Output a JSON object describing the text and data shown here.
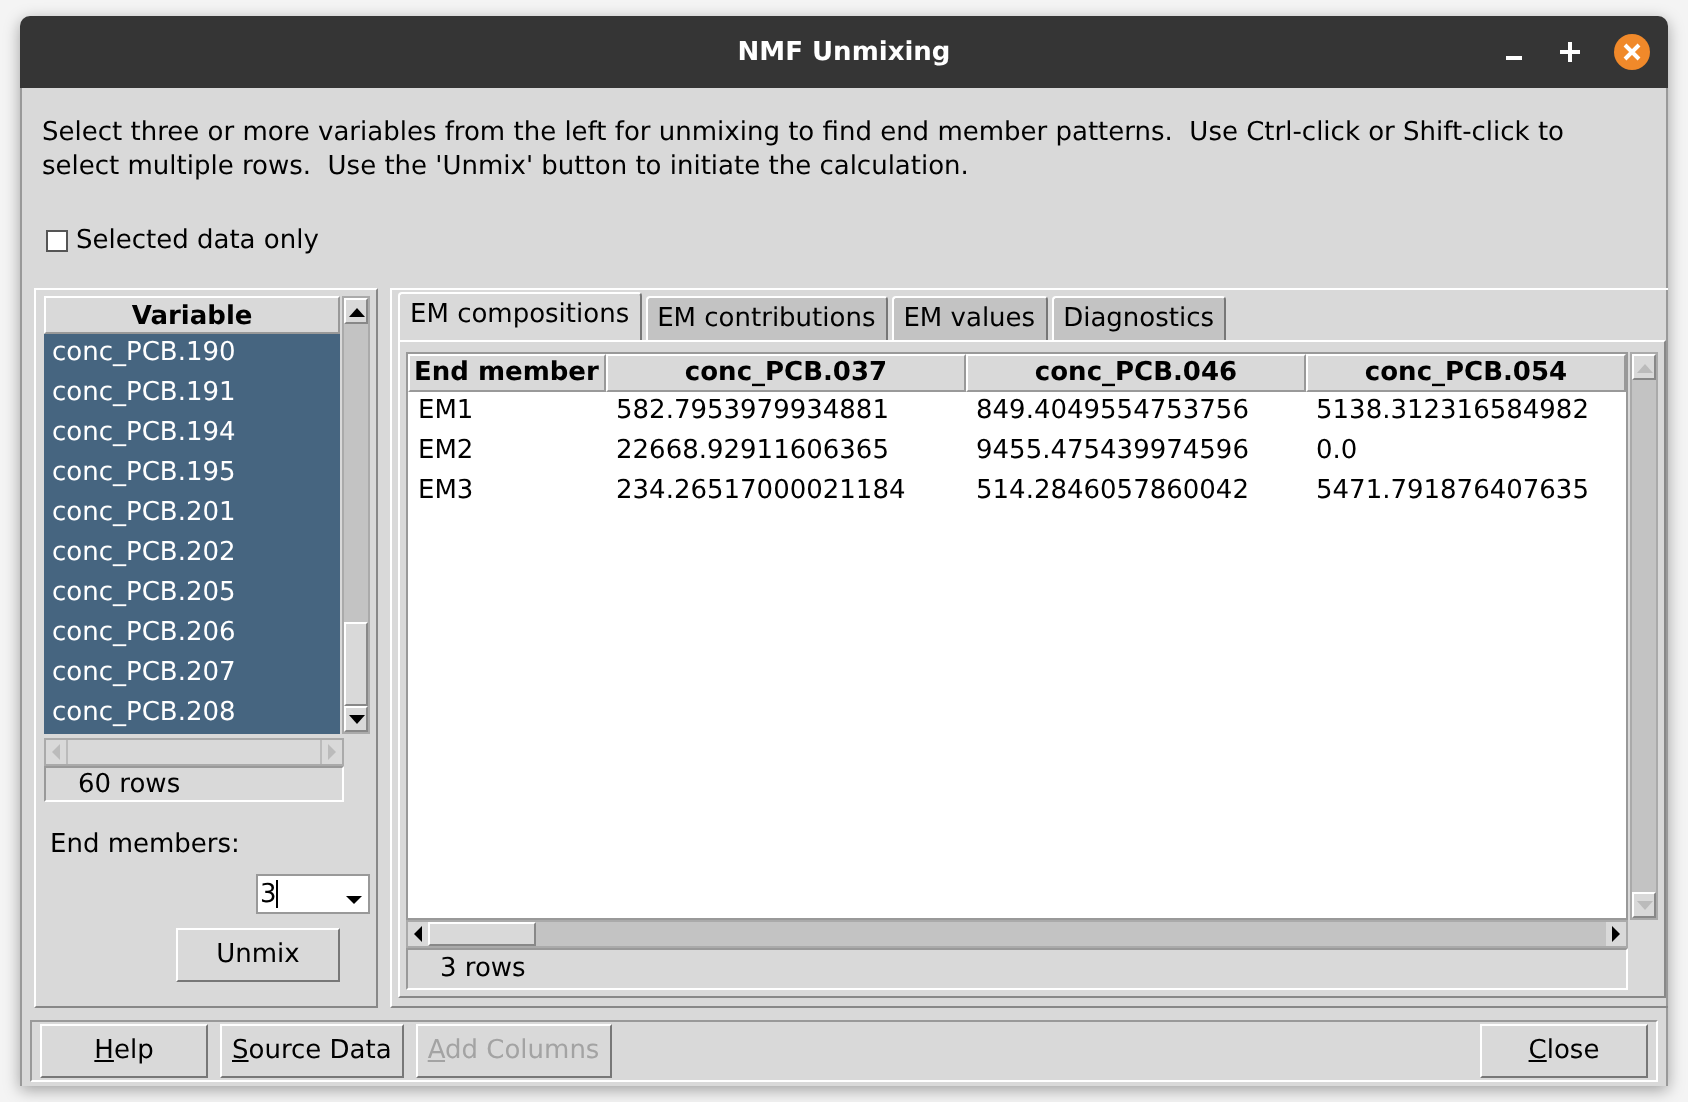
{
  "window": {
    "title": "NMF Unmixing"
  },
  "instructions": "Select three or more variables from the left for unmixing to find end member patterns.  Use Ctrl-click or Shift-click to select multiple rows.  Use the 'Unmix' button to initiate the calculation.",
  "selected_data_only": {
    "label": "Selected data only",
    "checked": false
  },
  "variables": {
    "column": "Variable",
    "rows": [
      {
        "name": "conc_PCB.190",
        "selected": true
      },
      {
        "name": "conc_PCB.191",
        "selected": true
      },
      {
        "name": "conc_PCB.194",
        "selected": true
      },
      {
        "name": "conc_PCB.195",
        "selected": true
      },
      {
        "name": "conc_PCB.201",
        "selected": true
      },
      {
        "name": "conc_PCB.202",
        "selected": true
      },
      {
        "name": "conc_PCB.205",
        "selected": true
      },
      {
        "name": "conc_PCB.206",
        "selected": true
      },
      {
        "name": "conc_PCB.207",
        "selected": true
      },
      {
        "name": "conc_PCB.208",
        "selected": true
      }
    ],
    "row_count": "60 rows"
  },
  "end_members": {
    "label": "End members:",
    "value": "3"
  },
  "unmix_button": "Unmix",
  "tabs": [
    {
      "label": "EM compositions",
      "selected": true
    },
    {
      "label": "EM contributions",
      "selected": false
    },
    {
      "label": "EM values",
      "selected": false
    },
    {
      "label": "Diagnostics",
      "selected": false
    }
  ],
  "table": {
    "columns": [
      "End member",
      "conc_PCB.037",
      "conc_PCB.046",
      "conc_PCB.054"
    ],
    "rows": [
      [
        "EM1",
        "582.7953979934881",
        "849.4049554753756",
        "5138.312316584982"
      ],
      [
        "EM2",
        "22668.92911606365",
        "9455.475439974596",
        "0.0"
      ],
      [
        "EM3",
        "234.26517000021184",
        "514.2846057860042",
        "5471.791876407635"
      ]
    ],
    "row_count": "3 rows"
  },
  "buttons": [
    {
      "label": "Help",
      "disabled": false,
      "underline_first": true
    },
    {
      "label": "Source Data",
      "disabled": false,
      "underline_first": true
    },
    {
      "label": "Add Columns",
      "disabled": true,
      "underline_first": true
    }
  ],
  "close_button": {
    "label": "Close",
    "disabled": false,
    "underline_first": true
  }
}
